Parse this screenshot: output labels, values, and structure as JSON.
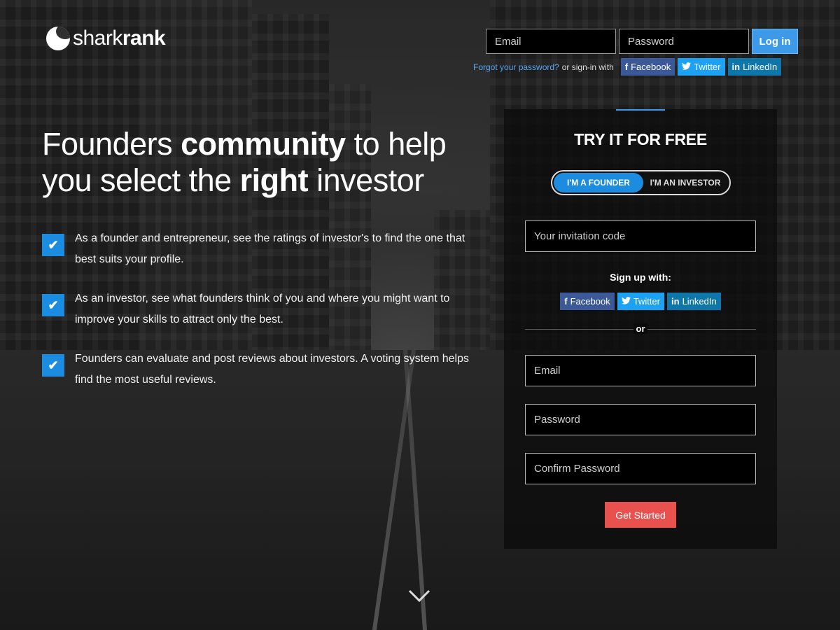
{
  "brand": {
    "name_light": "shark",
    "name_bold": "rank"
  },
  "login": {
    "email_placeholder": "Email",
    "password_placeholder": "Password",
    "login_label": "Log in",
    "forgot_label": "Forgot your password?",
    "or_sign_in": "or sign-in with",
    "social": [
      {
        "icon": "f",
        "label": "Facebook"
      },
      {
        "icon": "t",
        "label": "Twitter"
      },
      {
        "icon": "in",
        "label": "LinkedIn"
      }
    ]
  },
  "hero": {
    "headline_1": "Founders ",
    "headline_2": "community",
    "headline_3": " to help you select the ",
    "headline_4": "right",
    "headline_5": " investor",
    "features": [
      "As a founder and entrepreneur, see the ratings of investor's to find the one that best suits your profile.",
      "As an investor, see what founders think of you and where you might want to improve your skills to attract only the best.",
      "Founders can evaluate and post reviews about investors. A voting system helps find the most useful reviews."
    ]
  },
  "signup": {
    "title": "TRY IT FOR FREE",
    "founder_tab": "I'M A FOUNDER",
    "investor_tab": "I'M AN INVESTOR",
    "invite_placeholder": "Your invitation code",
    "sign_up_with": "Sign up with:",
    "or": "or",
    "email_placeholder": "Email",
    "password_placeholder": "Password",
    "confirm_placeholder": "Confirm Password",
    "submit_label": "Get Started"
  },
  "colors": {
    "accent_blue": "#1c8ce0",
    "cta_red": "#e9514e",
    "facebook": "#3b5998",
    "twitter": "#1da1f2",
    "linkedin": "#0e76a8"
  }
}
